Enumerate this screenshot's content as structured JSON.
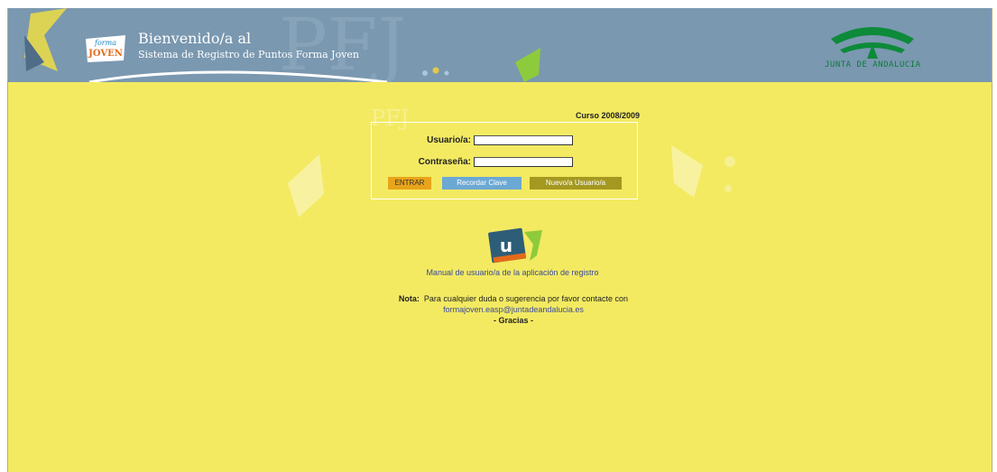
{
  "header": {
    "logo_top": "forma",
    "logo_bottom": "JOVEN",
    "title": "Bienvenido/a al",
    "subtitle": "Sistema de Registro de Puntos Forma Joven",
    "watermark": "PFJ",
    "org_name": "JUNTA DE ANDALUCIA"
  },
  "login": {
    "course": "Curso 2008/2009",
    "user_label": "Usuario/a:",
    "user_value": "",
    "password_label": "Contraseña:",
    "password_value": "",
    "buttons": {
      "enter": "ENTRAR",
      "remember": "Recordar Clave",
      "new_user": "Nuevo/a Usuario/a"
    }
  },
  "manual": {
    "icon_letter": "u",
    "link": "Manual de usuario/a de la aplicación de registro"
  },
  "note": {
    "label": "Nota:",
    "text": "Para cualquier duda o sugerencia por favor contacte con",
    "email": "formajoven.easp@juntadeandalucia.es",
    "thanks": "- Gracias -"
  },
  "colors": {
    "header_bg": "#7a98b0",
    "page_bg": "#f3ea62",
    "enter_button": "#e8a41a",
    "remember_button": "#6ca8d4",
    "new_user_button": "#a49820",
    "link": "#3a4a9a"
  }
}
